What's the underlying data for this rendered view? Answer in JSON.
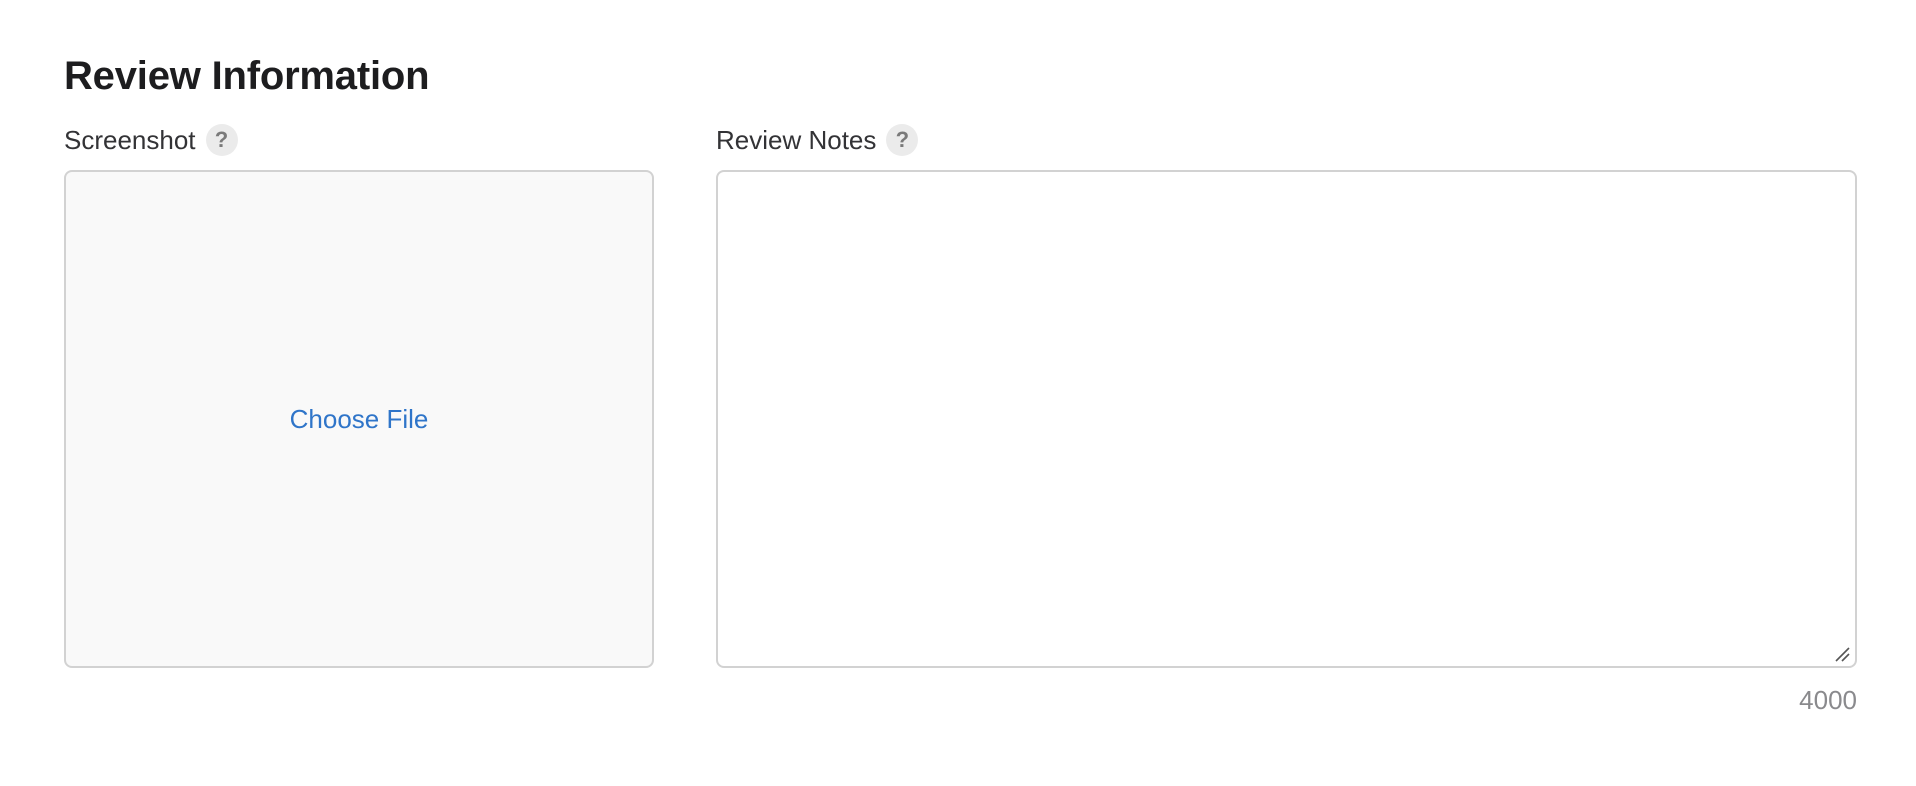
{
  "section": {
    "title": "Review Information"
  },
  "screenshot": {
    "label": "Screenshot",
    "help_icon": "?",
    "choose_file_label": "Choose File"
  },
  "review_notes": {
    "label": "Review Notes",
    "help_icon": "?",
    "value": "",
    "char_count": "4000"
  },
  "colors": {
    "link": "#2f75c9",
    "border": "#d2d2d2",
    "dropzone_bg": "#f9f9f9",
    "muted_text": "#8a8a8d"
  },
  "icons": {
    "help": "question-mark-circle",
    "resize": "resize-grip"
  }
}
